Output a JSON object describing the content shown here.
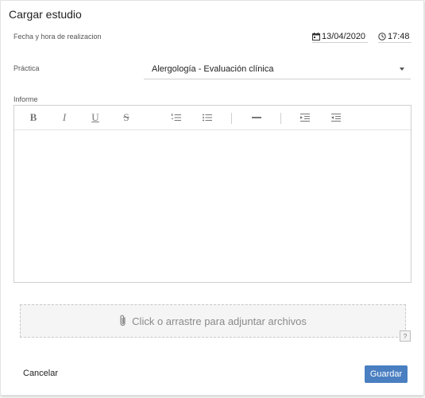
{
  "dialog": {
    "title": "Cargar estudio",
    "date_label": "Fecha y hora de realizacion",
    "date_value": "13/04/2020",
    "time_value": "17:48",
    "practica_label": "Práctica",
    "practica_value": "Alergología - Evaluación clínica",
    "informe_label": "Informe",
    "toolbar": {
      "bold": "B",
      "italic": "I",
      "underline": "U",
      "strike": "S"
    },
    "dropzone_text": "Click o arrastre para adjuntar archivos",
    "help_text": "?",
    "cancel_label": "Cancelar",
    "save_label": "Guardar"
  },
  "colors": {
    "primary": "#4a7fc1",
    "border": "#cfcfcf",
    "dropzone_bg": "#f5f5f5"
  }
}
